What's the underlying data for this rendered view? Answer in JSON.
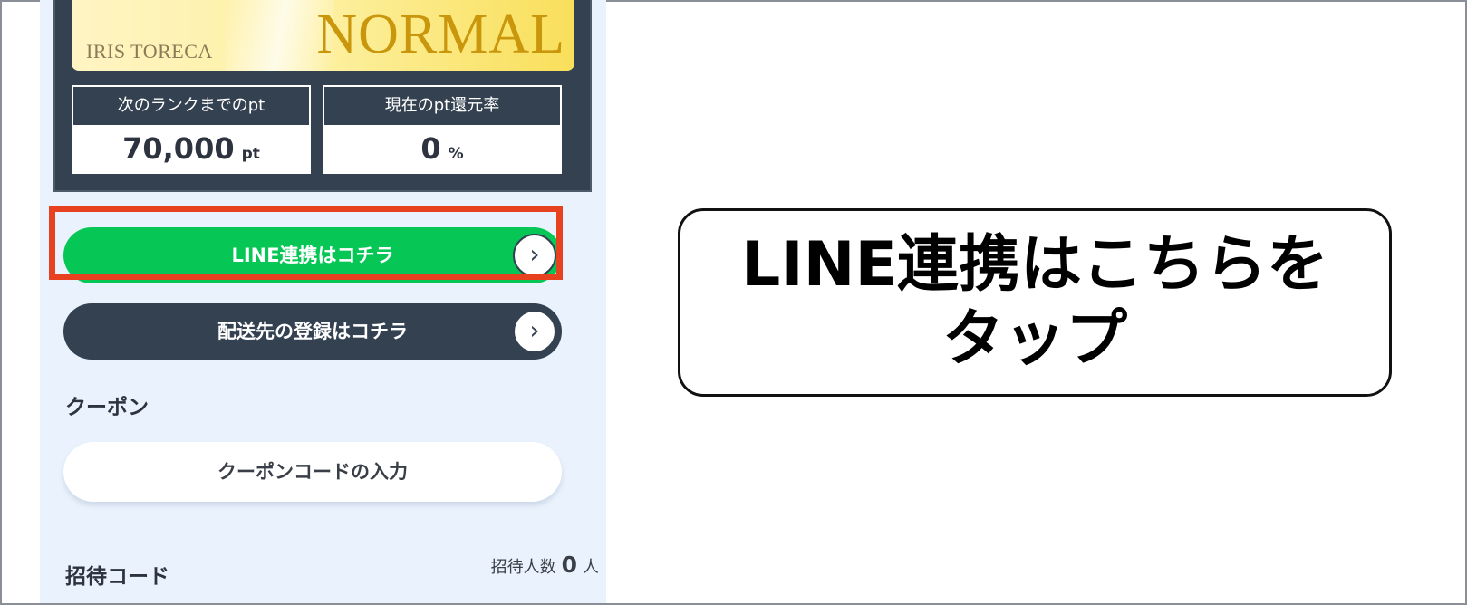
{
  "card": {
    "brand": "IRIS TORECA",
    "rank": "NORMAL"
  },
  "stats": [
    {
      "label": "次のランクまでのpt",
      "value": "70,000",
      "unit": "pt"
    },
    {
      "label": "現在のpt還元率",
      "value": "0",
      "unit": "%"
    }
  ],
  "buttons": {
    "line_link": "LINE連携はコチラ",
    "shipping": "配送先の登録はコチラ",
    "chevron": "›"
  },
  "coupon": {
    "title": "クーポン",
    "input_label": "クーポンコードの入力"
  },
  "invite": {
    "title": "招待コード",
    "count_label": "招待人数",
    "count": "0",
    "count_unit": "人"
  },
  "callout": {
    "text": "LINE連携はこちらをタップ"
  },
  "colors": {
    "line_green": "#06c755",
    "navy": "#334150",
    "highlight_red": "#e8411f",
    "card_gold": "#c9960c",
    "page_bg": "#eaf3fd"
  }
}
